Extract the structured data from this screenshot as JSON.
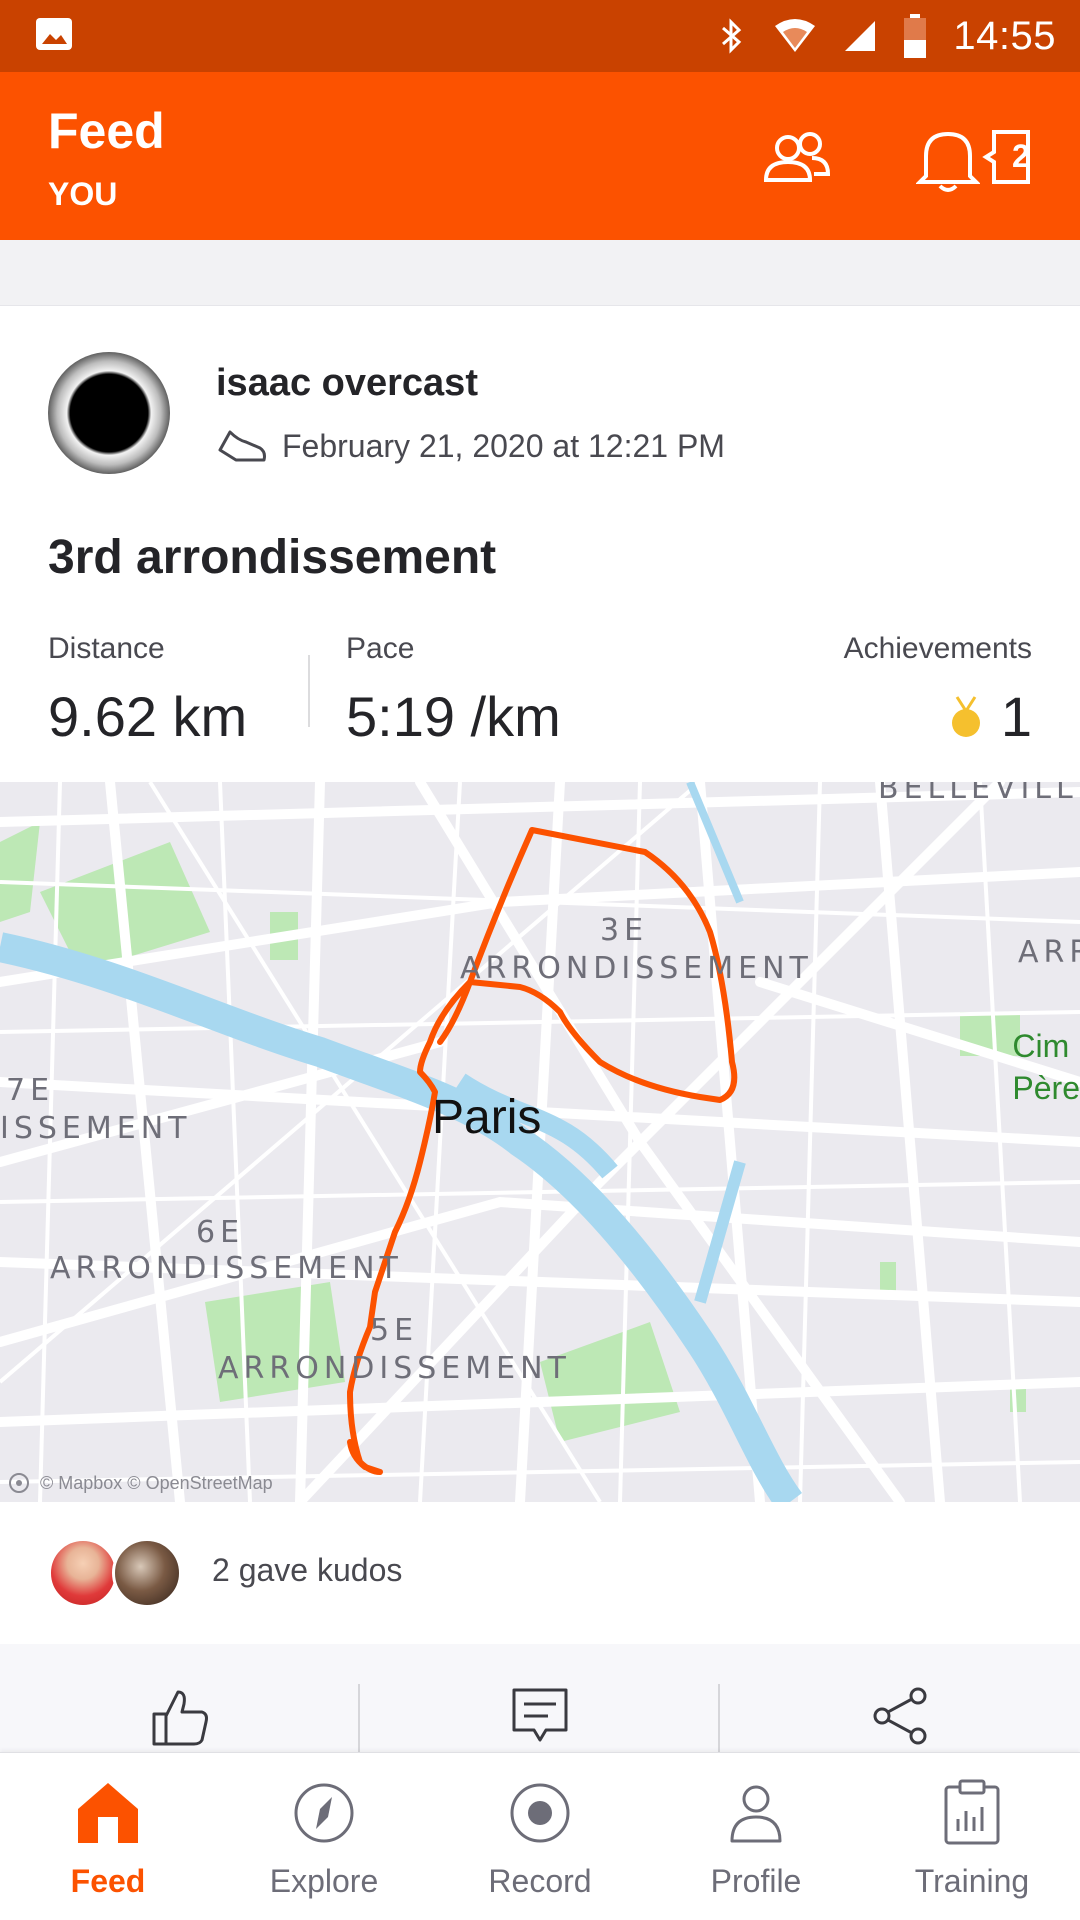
{
  "status_bar": {
    "time": "14:55"
  },
  "header": {
    "title": "Feed",
    "subtitle": "YOU",
    "notification_count": "2"
  },
  "activity": {
    "athlete_name": "isaac overcast",
    "date": "February 21, 2020 at 12:21 PM",
    "title": "3rd arrondissement",
    "stats": {
      "distance_label": "Distance",
      "distance_value": "9.62 km",
      "pace_label": "Pace",
      "pace_value": "5:19 /km",
      "achievements_label": "Achievements",
      "achievements_value": "1"
    }
  },
  "map": {
    "labels": {
      "belleville": "BELLEVILLE",
      "third_line1": "3E",
      "third_line2": "ARRONDISSEMENT",
      "arr_right": "ARR",
      "seventh_line1": "7E",
      "seventh_line2": "ISSEMENT",
      "sixth_line1": "6E",
      "sixth_line2": "ARRONDISSEMENT",
      "fifth_line1": "5E",
      "fifth_line2": "ARRONDISSEMENT",
      "city": "Paris",
      "cemetery_line1": "Cim",
      "cemetery_line2": "Père"
    },
    "attribution": "© Mapbox © OpenStreetMap",
    "route_color": "#fc5200",
    "water_color": "#a8d8f0",
    "park_color": "#bde8b5"
  },
  "kudos": {
    "text": "2 gave kudos"
  },
  "bottom_nav": {
    "items": [
      {
        "label": "Feed"
      },
      {
        "label": "Explore"
      },
      {
        "label": "Record"
      },
      {
        "label": "Profile"
      },
      {
        "label": "Training"
      }
    ]
  },
  "colors": {
    "brand": "#fc5200",
    "status_bar": "#c94200"
  }
}
